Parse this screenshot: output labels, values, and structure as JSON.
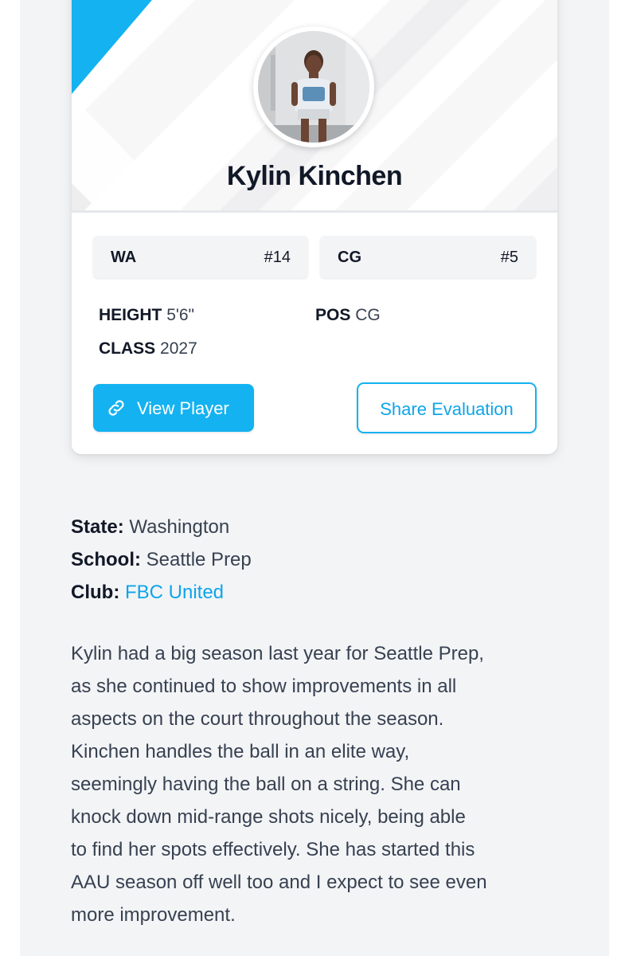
{
  "player": {
    "name": "Kylin Kinchen",
    "state_rank_label": "WA",
    "state_rank_value": "#14",
    "position_rank_label": "CG",
    "position_rank_value": "#5",
    "height_label": "HEIGHT",
    "height_value": "5'6\"",
    "pos_label": "POS",
    "pos_value": "CG",
    "class_label": "CLASS",
    "class_value": "2027"
  },
  "actions": {
    "view_player": "View Player",
    "share_evaluation": "Share Evaluation"
  },
  "details": {
    "state_label": "State:",
    "state_value": "Washington",
    "school_label": "School:",
    "school_value": "Seattle Prep",
    "club_label": "Club:",
    "club_value": "FBC United"
  },
  "evaluation": {
    "lines": [
      "Kylin had a big season last year for Seattle Prep,",
      "as she continued to show improvements in all",
      "aspects on the court throughout the season.",
      "Kinchen handles the ball in an elite way,",
      "seemingly having the ball on a string. She can",
      "knock down mid-range shots nicely, being able",
      "to find her spots effectively. She has started this",
      "AAU season off well too and I expect to see even",
      "more improvement."
    ]
  },
  "colors": {
    "accent": "#14b2f0",
    "link": "#0ea5e9",
    "background": "#f3f4f6"
  },
  "icons": {
    "view_player": "link-icon"
  }
}
